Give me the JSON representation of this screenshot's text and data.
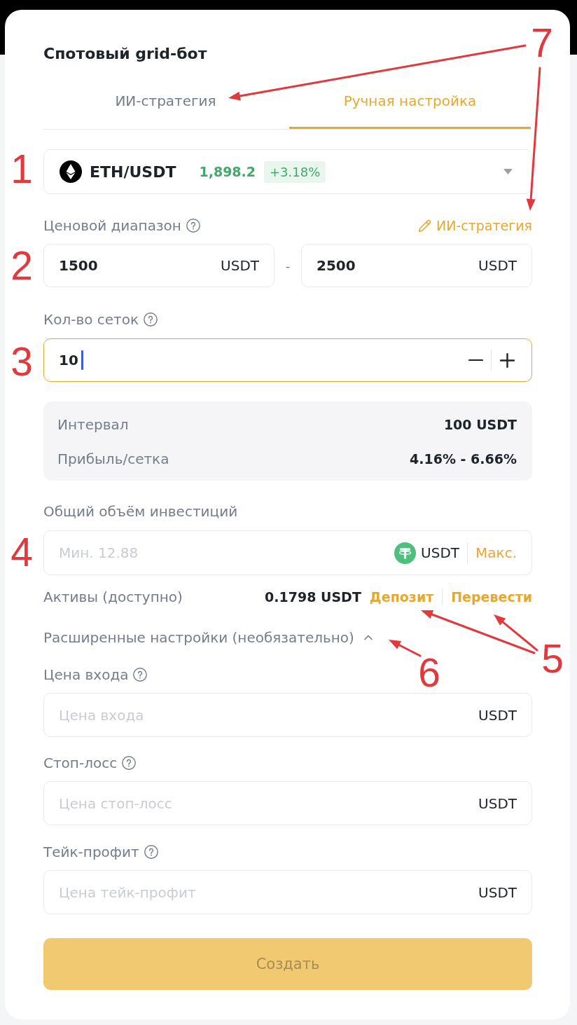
{
  "title": "Спотовый grid-бот",
  "tabs": [
    {
      "label": "ИИ-стратегия",
      "selected": false
    },
    {
      "label": "Ручная настройка",
      "selected": true
    }
  ],
  "pair": {
    "symbol": "ETH/USDT",
    "price": "1,898.2",
    "change": "+3.18%"
  },
  "price_range": {
    "label": "Ценовой диапазон",
    "help": true,
    "link": "ИИ-стратегия",
    "separator": "-",
    "fields": [
      {
        "value": "1500",
        "unit": "USDT"
      },
      {
        "value": "2500",
        "unit": "USDT"
      }
    ]
  },
  "grid_count": {
    "label": "Кол-во сеток",
    "help": true,
    "value": "10",
    "focused": true
  },
  "summary": [
    {
      "label": "Интервал",
      "value": "100 USDT"
    },
    {
      "label": "Прибыль/сетка",
      "value": "4.16% - 6.66%"
    }
  ],
  "investment": {
    "label": "Общий объём инвестиций",
    "placeholder": "Мин. 12.88",
    "unit": "USDT",
    "max": "Макс."
  },
  "assets": {
    "label": "Активы (доступно)",
    "value": "0.1798 USDT",
    "actions": [
      "Депозит",
      "Перевести"
    ]
  },
  "advanced": {
    "label": "Расширенные настройки (необязательно)",
    "expanded": true,
    "fields": [
      {
        "label": "Цена входа",
        "help": true,
        "placeholder": "Цена входа",
        "unit": "USDT"
      },
      {
        "label": "Стоп-лосс",
        "help": true,
        "placeholder": "Цена стоп-лосс",
        "unit": "USDT"
      },
      {
        "label": "Тейк-профит",
        "help": true,
        "placeholder": "Цена тейк-профит",
        "unit": "USDT"
      }
    ]
  },
  "submit": {
    "label": "Создать",
    "disabled": true
  },
  "annotations": [
    {
      "label": "7"
    },
    {
      "label": "1"
    },
    {
      "label": "2"
    },
    {
      "label": "3"
    },
    {
      "label": "4"
    },
    {
      "label": "5"
    },
    {
      "label": "6"
    }
  ]
}
